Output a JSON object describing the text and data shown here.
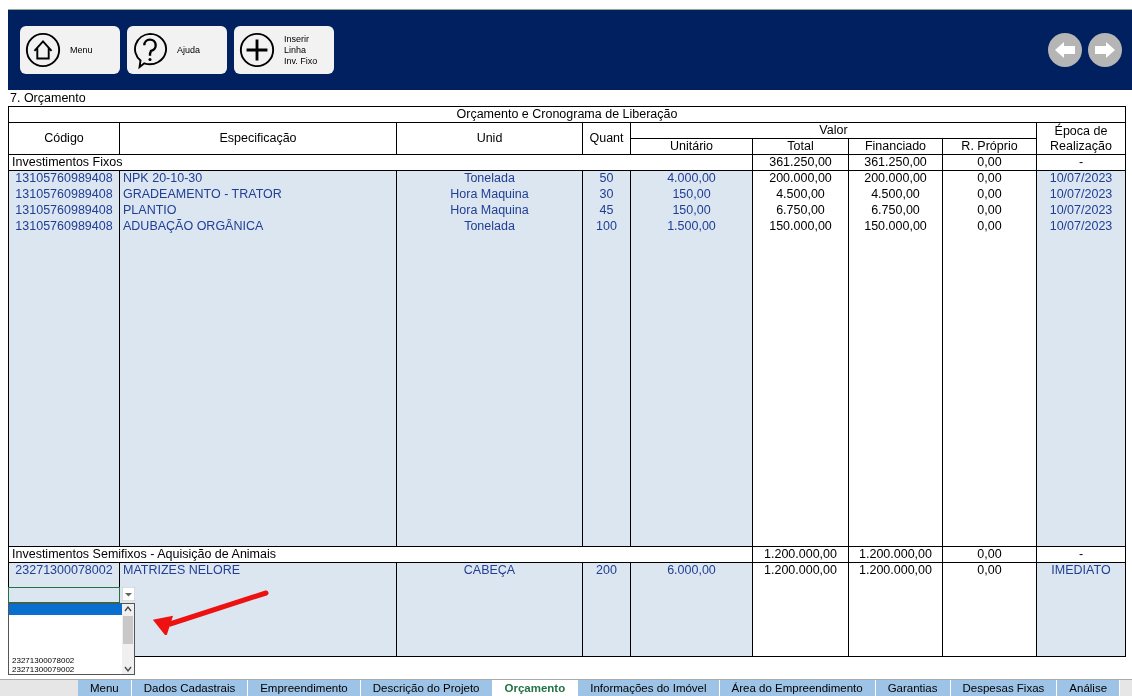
{
  "toolbar": {
    "buttons": [
      {
        "kind": "home",
        "label": "Menu"
      },
      {
        "kind": "help",
        "label": "Ajuda"
      },
      {
        "kind": "add",
        "label": "Inserir\nLinha\nInv. Fixo"
      }
    ]
  },
  "sheet_title": "7. Orçamento",
  "table": {
    "title": "Orçamento e Cronograma de Liberação",
    "columns": {
      "codigo": "Código",
      "especificacao": "Especificação",
      "unid": "Unid",
      "quant": "Quant",
      "valor": "Valor",
      "unitario": "Unitário",
      "total": "Total",
      "financiado": "Financiado",
      "proprio": "R. Próprio",
      "epoca": "Época de Realização"
    },
    "sections": [
      {
        "label": "Investimentos Fixos",
        "total": "361.250,00",
        "financiado": "361.250,00",
        "proprio": "0,00",
        "epoca": "-",
        "rows": [
          {
            "codigo": "13105760989408",
            "especificacao": "NPK 20-10-30",
            "unid": "Tonelada",
            "quant": "50",
            "unitario": "4.000,00",
            "total": "200.000,00",
            "financiado": "200.000,00",
            "proprio": "0,00",
            "epoca": "10/07/2023"
          },
          {
            "codigo": "13105760989408",
            "especificacao": "GRADEAMENTO - TRATOR",
            "unid": "Hora Maquina",
            "quant": "30",
            "unitario": "150,00",
            "total": "4.500,00",
            "financiado": "4.500,00",
            "proprio": "0,00",
            "epoca": "10/07/2023"
          },
          {
            "codigo": "13105760989408",
            "especificacao": "PLANTIO",
            "unid": "Hora Maquina",
            "quant": "45",
            "unitario": "150,00",
            "total": "6.750,00",
            "financiado": "6.750,00",
            "proprio": "0,00",
            "epoca": "10/07/2023"
          },
          {
            "codigo": "13105760989408",
            "especificacao": "ADUBAÇÃO ORGÂNICA",
            "unid": "Tonelada",
            "quant": "100",
            "unitario": "1.500,00",
            "total": "150.000,00",
            "financiado": "150.000,00",
            "proprio": "0,00",
            "epoca": "10/07/2023"
          }
        ]
      },
      {
        "label": "Investimentos Semifixos - Aquisição de Animais",
        "total": "1.200.000,00",
        "financiado": "1.200.000,00",
        "proprio": "0,00",
        "epoca": "-",
        "rows": [
          {
            "codigo": "23271300078002",
            "especificacao": "MATRIZES NELORE",
            "unid": "CABEÇA",
            "quant": "200",
            "unitario": "6.000,00",
            "total": "1.200.000,00",
            "financiado": "1.200.000,00",
            "proprio": "0,00",
            "epoca": "IMEDIATO"
          }
        ]
      }
    ]
  },
  "dropdown": {
    "options": [
      "23271300078002",
      "23271300079002"
    ]
  },
  "sheet_tabs": [
    {
      "label": "Menu",
      "selected": false
    },
    {
      "label": "Dados Cadastrais",
      "selected": false
    },
    {
      "label": "Empreendimento",
      "selected": false
    },
    {
      "label": "Descrição do Projeto",
      "selected": false
    },
    {
      "label": "Orçamento",
      "selected": true
    },
    {
      "label": "Informações do Imóvel",
      "selected": false
    },
    {
      "label": "Área do Empreendimento",
      "selected": false
    },
    {
      "label": "Garantias",
      "selected": false
    },
    {
      "label": "Despesas Fixas",
      "selected": false
    },
    {
      "label": "Análise",
      "selected": false
    }
  ]
}
